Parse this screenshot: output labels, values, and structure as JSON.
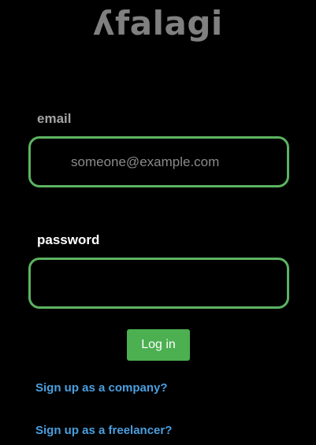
{
  "app": {
    "logo_text": "ʎfalagi"
  },
  "login_form": {
    "email_label": "email",
    "email_placeholder": "someone@example.com",
    "email_value": "",
    "password_label": "password",
    "password_value": "",
    "login_button_label": "Log in"
  },
  "links": {
    "signup_company": "Sign up as a company?",
    "signup_freelancer": "Sign up as a freelancer?"
  },
  "colors": {
    "background": "#000000",
    "input_border": "#5cb360",
    "button_background": "#4caf50",
    "link": "#4a9fe0",
    "logo": "#808080"
  }
}
